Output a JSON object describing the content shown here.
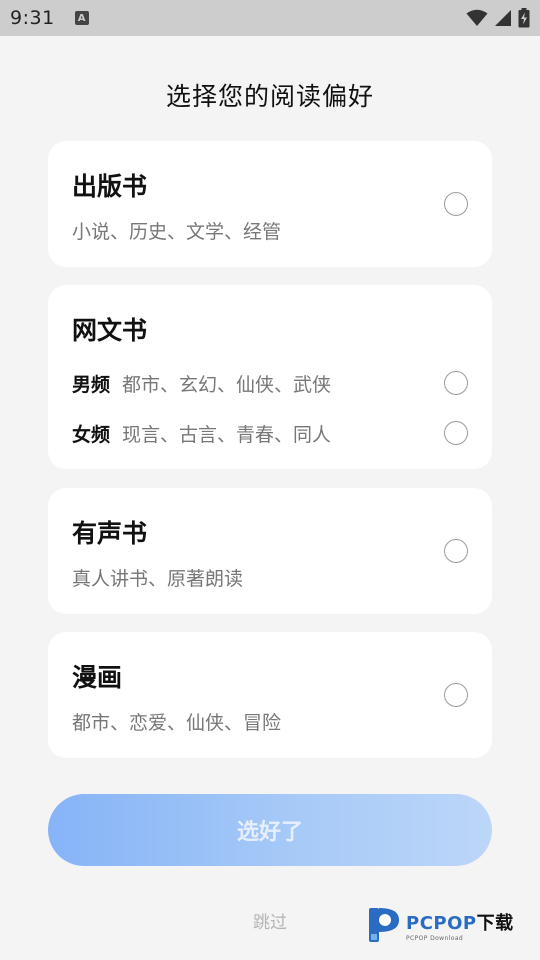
{
  "status_bar": {
    "time": "9:31",
    "notification_glyph": "A",
    "icons": [
      "wifi-icon",
      "cell-signal-icon",
      "battery-charging-icon"
    ]
  },
  "page": {
    "title": "选择您的阅读偏好"
  },
  "cards": [
    {
      "title": "出版书",
      "desc": "小说、历史、文学、经管"
    },
    {
      "title": "网文书",
      "subs": [
        {
          "label": "男频",
          "desc": "都市、玄幻、仙侠、武侠"
        },
        {
          "label": "女频",
          "desc": "现言、古言、青春、同人"
        }
      ]
    },
    {
      "title": "有声书",
      "desc": "真人讲书、原著朗读"
    },
    {
      "title": "漫画",
      "desc": "都市、恋爱、仙侠、冒险"
    }
  ],
  "actions": {
    "confirm_label": "选好了",
    "skip_label": "跳过"
  },
  "watermark": {
    "brand": "PCPOP",
    "brand_suffix": "下载",
    "tagline": "PCPOP Download"
  },
  "colors": {
    "background": "#f4f4f4",
    "card": "#ffffff",
    "accent_start": "#86b4f7",
    "accent_end": "#bcd6f8",
    "muted_text": "#777777"
  }
}
